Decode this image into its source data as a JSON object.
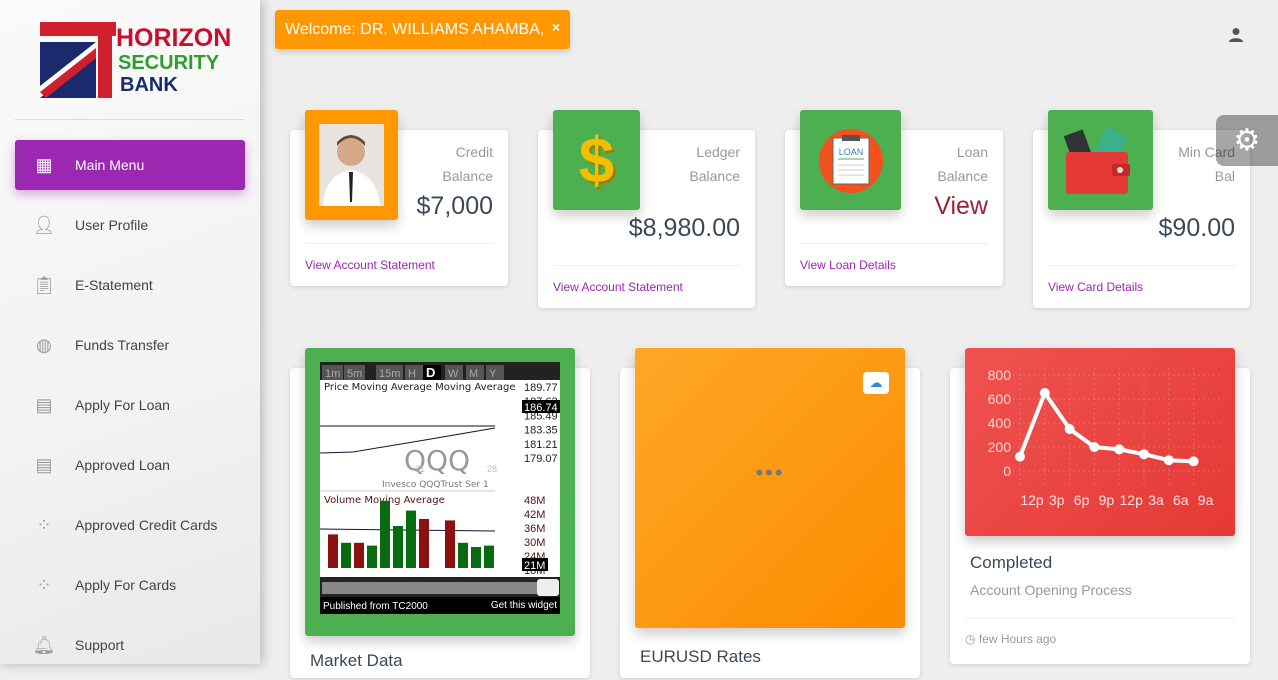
{
  "sidebar": {
    "logo": {
      "line1": "HORIZON",
      "line2": "SECURITY",
      "line3": "BANK"
    },
    "items": [
      {
        "label": "Main Menu",
        "icon": "dashboard-icon",
        "active": true
      },
      {
        "label": "User Profile",
        "icon": "person-icon"
      },
      {
        "label": "E-Statement",
        "icon": "clipboard-icon"
      },
      {
        "label": "Funds Transfer",
        "icon": "globe-icon"
      },
      {
        "label": "Apply For Loan",
        "icon": "library-books-icon"
      },
      {
        "label": "Approved Loan",
        "icon": "library-books-icon"
      },
      {
        "label": "Approved Credit Cards",
        "icon": "bubble-chart-icon"
      },
      {
        "label": "Apply For Cards",
        "icon": "bubble-chart-icon"
      },
      {
        "label": "Support",
        "icon": "bell-icon"
      }
    ]
  },
  "header": {
    "welcome": "Welcome: DR. WILLIAMS AHAMBA,",
    "close": "×"
  },
  "stats": [
    {
      "cat1": "Credit",
      "cat2": "Balance",
      "value": "$7,000",
      "link": "View Account Statement"
    },
    {
      "cat1": "Ledger",
      "cat2": "Balance",
      "value": "$8,980.00",
      "link": "View Account Statement"
    },
    {
      "cat1": "Loan",
      "cat2": "Balance",
      "value": "View",
      "link": "View Loan Details",
      "loan_label": "LOAN"
    },
    {
      "cat1": "Min Card",
      "cat2": "Bal",
      "value": "$90.00",
      "link": "View Card Details"
    }
  ],
  "widget": {
    "timeframes": [
      "1m",
      "5m",
      "15m",
      "H",
      "D",
      "W",
      "M",
      "Y"
    ],
    "active": "D",
    "price_title": "Price Moving Average Moving Average",
    "price_ticks": [
      "189.77",
      "187.63",
      "185.49",
      "183.35",
      "181.21",
      "179.07"
    ],
    "price_current": "186.74",
    "symbol": "QQQ",
    "symbol_name": "Invesco QQQTrust Ser 1",
    "date_labels": [
      "21",
      "28"
    ],
    "volume_title": "Volume Moving Average",
    "volume_ticks": [
      "48M",
      "42M",
      "36M",
      "30M",
      "24M",
      "18M"
    ],
    "volume_current": "21M",
    "published": "Published from TC2000",
    "get": "Get this widget",
    "volumes": [
      {
        "v": 24,
        "c": "down"
      },
      {
        "v": 18,
        "c": "up"
      },
      {
        "v": 18,
        "c": "down"
      },
      {
        "v": 16,
        "c": "up"
      },
      {
        "v": 48,
        "c": "up"
      },
      {
        "v": 30,
        "c": "up"
      },
      {
        "v": 41,
        "c": "up"
      },
      {
        "v": 35,
        "c": "down"
      },
      {
        "v": 0,
        "c": "none"
      },
      {
        "v": 34,
        "c": "down"
      },
      {
        "v": 18,
        "c": "up"
      },
      {
        "v": 15,
        "c": "up"
      },
      {
        "v": 16,
        "c": "up"
      }
    ]
  },
  "bottom": [
    {
      "title": "Market Data"
    },
    {
      "title": "EURUSD Rates",
      "loading": "•••"
    },
    {
      "title": "Completed",
      "subtitle": "Account Opening Process",
      "time": "few Hours ago"
    }
  ],
  "chart_data": {
    "type": "line",
    "categories": [
      "12p",
      "3p",
      "6p",
      "9p",
      "12p",
      "3a",
      "6a",
      "9a"
    ],
    "values": [
      120,
      650,
      350,
      200,
      180,
      140,
      90,
      80
    ],
    "yticks": [
      0,
      200,
      400,
      600,
      800
    ],
    "ylim": [
      0,
      800
    ],
    "grid": true,
    "color": "#ffffff",
    "background": "#e53935"
  },
  "colors": {
    "accent": "#9c27b0",
    "orange": "#ff9800",
    "green": "#4caf50",
    "red": "#e53935"
  }
}
